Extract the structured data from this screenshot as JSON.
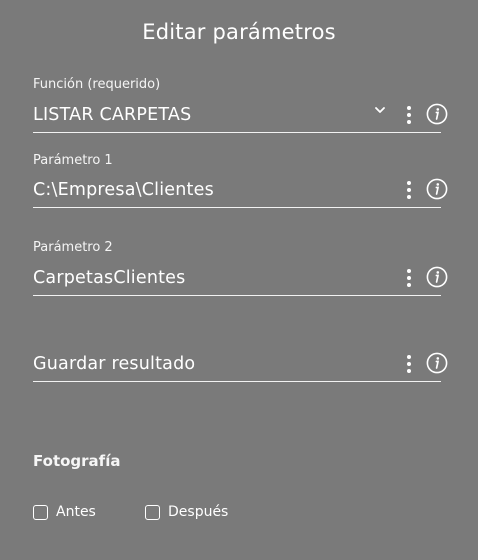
{
  "dialog": {
    "title": "Editar parámetros"
  },
  "fields": {
    "funcion": {
      "label": "Función (requerido)",
      "value": "LISTAR CARPETAS"
    },
    "parametro1": {
      "label": "Parámetro 1",
      "value": "C:\\Empresa\\Clientes"
    },
    "parametro2": {
      "label": "Parámetro 2",
      "value": "CarpetasClientes"
    },
    "guardar": {
      "label": "",
      "value": "Guardar resultado"
    }
  },
  "photo": {
    "title": "Fotografía",
    "options": [
      {
        "label": "Antes",
        "checked": false
      },
      {
        "label": "Después",
        "checked": false
      }
    ]
  },
  "icons": {
    "dropdown": "chevron-down-icon",
    "menu": "more-vertical-icon",
    "info": "info-icon"
  },
  "colors": {
    "background": "#7a7a7a",
    "text": "#ffffff"
  }
}
